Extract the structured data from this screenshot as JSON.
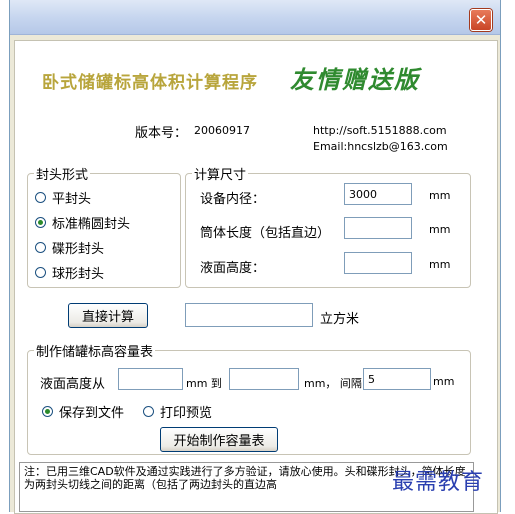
{
  "window": {
    "close_glyph": "✕"
  },
  "header": {
    "app_title": "卧式储罐标高体积计算程序",
    "edition": "友情赠送版",
    "version_label": "版本号：",
    "version": "20060917",
    "url": "http://soft.5151888.com",
    "email": "Email:hncslzb@163.com"
  },
  "head_type": {
    "legend": "封头形式",
    "options": [
      {
        "label": "平封头",
        "selected": false
      },
      {
        "label": "标准椭圆封头",
        "selected": true
      },
      {
        "label": "碟形封头",
        "selected": false
      },
      {
        "label": "球形封头",
        "selected": false
      }
    ]
  },
  "calc_size": {
    "legend": "计算尺寸",
    "inner_diameter_label": "设备内径：",
    "inner_diameter_value": "3000",
    "inner_diameter_unit": "mm",
    "cylinder_length_label": "筒体长度（包括直边）",
    "cylinder_length_value": "",
    "cylinder_length_unit": "mm",
    "liquid_height_label": "液面高度：",
    "liquid_height_value": "",
    "liquid_height_unit": "mm"
  },
  "direct_calc": {
    "button_label": "直接计算",
    "result_value": "",
    "result_unit": "立方米"
  },
  "table_section": {
    "legend": "制作储罐标高容量表",
    "from_label": "液面高度从",
    "from_value": "",
    "to_label": "mm 到",
    "to_value": "",
    "interval_label": "mm， 间隔",
    "interval_value": "5",
    "interval_unit": "mm",
    "output_options": [
      {
        "label": "保存到文件",
        "selected": true
      },
      {
        "label": "打印预览",
        "selected": false
      }
    ],
    "start_button_label": "开始制作容量表"
  },
  "note": {
    "text": "注：已用三维CAD软件及通过实践进行了多方验证，请放心使用。头和碟形封头，简体长度为两封头切线之间的距离（包括了两边封头的直边高"
  },
  "watermark": "最需教育"
}
